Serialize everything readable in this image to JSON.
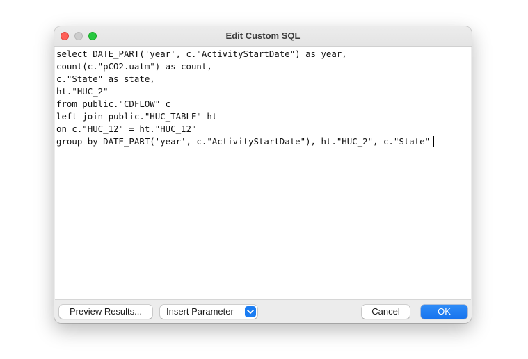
{
  "window": {
    "title": "Edit Custom SQL"
  },
  "editor": {
    "lines": [
      "select DATE_PART('year', c.\"ActivityStartDate\") as year,",
      "count(c.\"pCO2.uatm\") as count,",
      "c.\"State\" as state,",
      "ht.\"HUC_2\"",
      "from public.\"CDFLOW\" c",
      "left join public.\"HUC_TABLE\" ht",
      "on c.\"HUC_12\" = ht.\"HUC_12\"",
      "group by DATE_PART('year', c.\"ActivityStartDate\"), ht.\"HUC_2\", c.\"State\""
    ]
  },
  "footer": {
    "preview_label": "Preview Results...",
    "insert_label": "Insert Parameter",
    "cancel_label": "Cancel",
    "ok_label": "OK"
  },
  "colors": {
    "accent": "#1a7cf2",
    "close": "#ff5f57",
    "minimize": "#cdcdcd",
    "zoom": "#28c840"
  },
  "icons": {
    "dropdown": "chevron-down-icon"
  }
}
